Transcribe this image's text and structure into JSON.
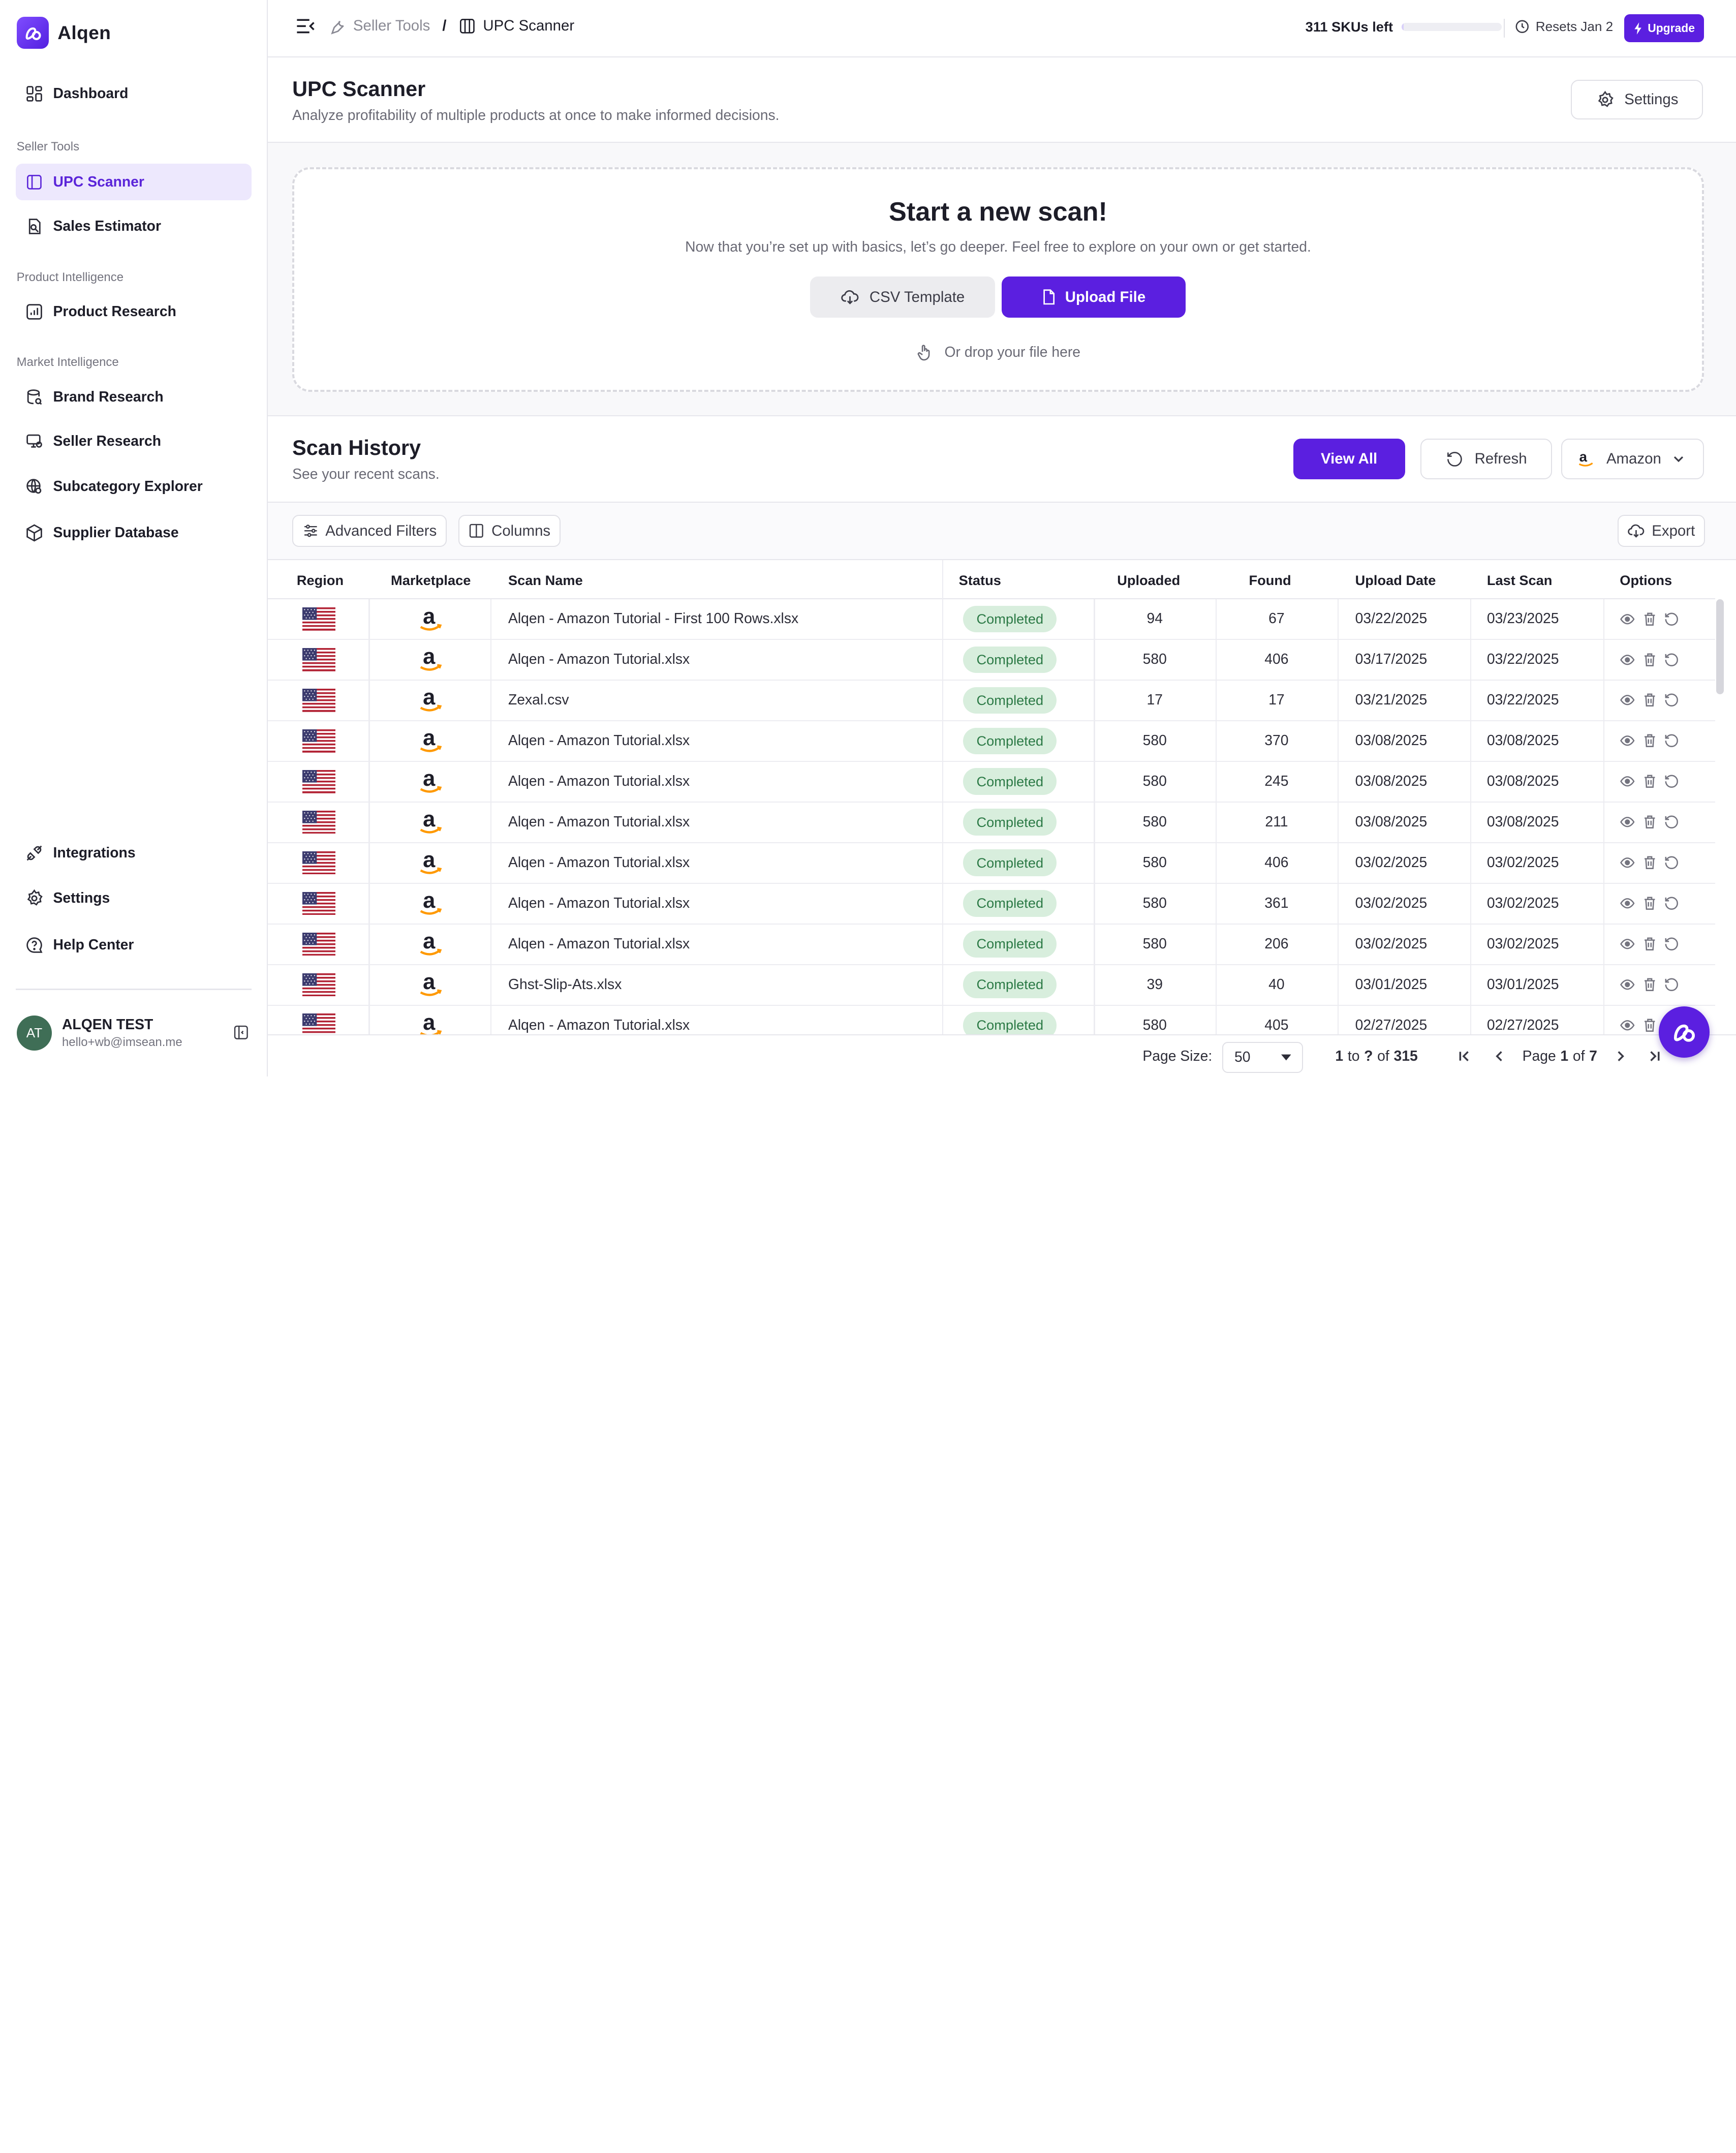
{
  "app": {
    "name": "Alqen"
  },
  "sidebar": {
    "dashboard": "Dashboard",
    "groups": {
      "seller_tools": "Seller Tools",
      "product_intelligence": "Product Intelligence",
      "market_intelligence": "Market Intelligence"
    },
    "items": {
      "upc_scanner": "UPC Scanner",
      "sales_estimator": "Sales Estimator",
      "product_research": "Product Research",
      "brand_research": "Brand Research",
      "seller_research": "Seller Research",
      "subcategory_explorer": "Subcategory Explorer",
      "supplier_database": "Supplier Database",
      "integrations": "Integrations",
      "settings": "Settings",
      "help_center": "Help Center"
    },
    "user": {
      "initials": "AT",
      "name": "ALQEN TEST",
      "email": "hello+wb@imsean.me"
    }
  },
  "topbar": {
    "breadcrumb": [
      "Seller Tools",
      "/",
      "UPC Scanner"
    ],
    "quota_count": "311",
    "quota_label": "SKUs left",
    "quota_fraction": 0.02,
    "resets": "Resets Jan 2",
    "upgrade": "Upgrade"
  },
  "page": {
    "title": "UPC Scanner",
    "subtitle": "Analyze profitability of multiple products at once to make informed decisions.",
    "settings_label": "Settings"
  },
  "scan": {
    "title": "Start a new scan!",
    "subtitle": "Now that you’re set up with basics, let’s go deeper. Feel free to explore on your own or get started.",
    "csv_template": "CSV Template",
    "upload_file": "Upload File",
    "drop_hint": "Or drop your file here"
  },
  "history": {
    "title": "Scan History",
    "subtitle": "See your recent scans.",
    "view_all": "View All",
    "refresh": "Refresh",
    "marketplace": "Amazon",
    "advanced_filters": "Advanced Filters",
    "columns": "Columns",
    "export": "Export",
    "headers": [
      "Region",
      "Marketplace",
      "Scan Name",
      "Status",
      "Uploaded",
      "Found",
      "Upload Date",
      "Last Scan",
      "Options"
    ],
    "rows": [
      {
        "name": "Alqen - Amazon Tutorial - First 100 Rows.xlsx",
        "status": "Completed",
        "uploaded": "94",
        "found": "67",
        "upload_date": "03/22/2025",
        "last_scan": "03/23/2025"
      },
      {
        "name": "Alqen - Amazon Tutorial.xlsx",
        "status": "Completed",
        "uploaded": "580",
        "found": "406",
        "upload_date": "03/17/2025",
        "last_scan": "03/22/2025"
      },
      {
        "name": "Zexal.csv",
        "status": "Completed",
        "uploaded": "17",
        "found": "17",
        "upload_date": "03/21/2025",
        "last_scan": "03/22/2025"
      },
      {
        "name": "Alqen - Amazon Tutorial.xlsx",
        "status": "Completed",
        "uploaded": "580",
        "found": "370",
        "upload_date": "03/08/2025",
        "last_scan": "03/08/2025"
      },
      {
        "name": "Alqen - Amazon Tutorial.xlsx",
        "status": "Completed",
        "uploaded": "580",
        "found": "245",
        "upload_date": "03/08/2025",
        "last_scan": "03/08/2025"
      },
      {
        "name": "Alqen - Amazon Tutorial.xlsx",
        "status": "Completed",
        "uploaded": "580",
        "found": "211",
        "upload_date": "03/08/2025",
        "last_scan": "03/08/2025"
      },
      {
        "name": "Alqen - Amazon Tutorial.xlsx",
        "status": "Completed",
        "uploaded": "580",
        "found": "406",
        "upload_date": "03/02/2025",
        "last_scan": "03/02/2025"
      },
      {
        "name": "Alqen - Amazon Tutorial.xlsx",
        "status": "Completed",
        "uploaded": "580",
        "found": "361",
        "upload_date": "03/02/2025",
        "last_scan": "03/02/2025"
      },
      {
        "name": "Alqen - Amazon Tutorial.xlsx",
        "status": "Completed",
        "uploaded": "580",
        "found": "206",
        "upload_date": "03/02/2025",
        "last_scan": "03/02/2025"
      },
      {
        "name": "Ghst-Slip-Ats.xlsx",
        "status": "Completed",
        "uploaded": "39",
        "found": "40",
        "upload_date": "03/01/2025",
        "last_scan": "03/01/2025"
      },
      {
        "name": "Alqen - Amazon Tutorial.xlsx",
        "status": "Completed",
        "uploaded": "580",
        "found": "405",
        "upload_date": "02/27/2025",
        "last_scan": "02/27/2025"
      }
    ]
  },
  "footer": {
    "page_size_label": "Page Size:",
    "page_size": "50",
    "range_start": "1",
    "range_to": "to",
    "range_end": "?",
    "range_of": "of",
    "total": "315",
    "page_label": "Page",
    "page_current": "1",
    "page_of": "of",
    "page_total": "7"
  },
  "colors": {
    "accent": "#5b1fe0",
    "active_bg": "#ede8fd",
    "status_bg": "#d8eedd",
    "status_text": "#2c7a46"
  },
  "icons": [
    "dashboard-icon",
    "upc-scanner-icon",
    "sales-estimator-icon",
    "product-research-icon",
    "brand-research-icon",
    "seller-research-icon",
    "subcategory-explorer-icon",
    "supplier-database-icon",
    "integrations-icon",
    "settings-icon",
    "help-center-icon",
    "menu-collapse-icon",
    "wrench-icon",
    "clock-icon",
    "lightning-icon",
    "cloud-download-icon",
    "file-icon",
    "hand-pointer-icon",
    "refresh-icon",
    "amazon-logo-icon",
    "chevron-down-icon",
    "filters-icon",
    "columns-icon",
    "export-icon",
    "us-flag-icon",
    "view-icon",
    "trash-icon",
    "rescan-icon",
    "first-page-icon",
    "prev-page-icon",
    "next-page-icon",
    "last-page-icon",
    "chat-fab-icon"
  ]
}
